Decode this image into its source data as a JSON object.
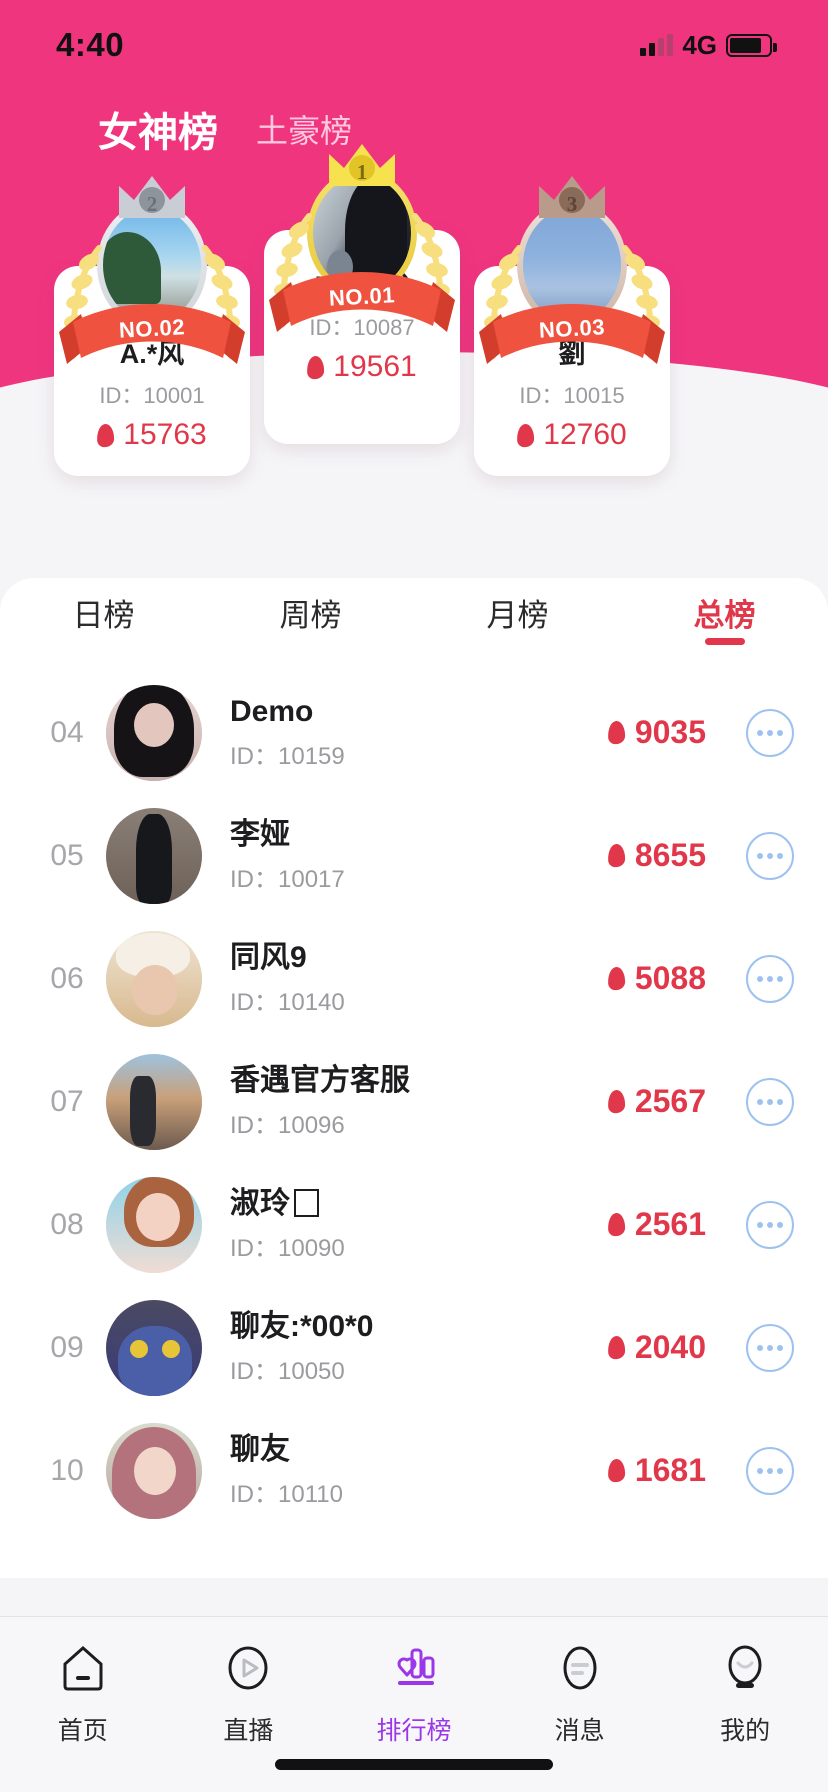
{
  "status_bar": {
    "time": "4:40",
    "network": "4G",
    "signal_icon": "signal-bars-icon",
    "battery_icon": "battery-icon"
  },
  "header": {
    "tabs": [
      {
        "label": "女神榜",
        "active": true
      },
      {
        "label": "土豪榜",
        "active": false
      }
    ]
  },
  "podium": [
    {
      "rank": 2,
      "rank_label": "NO.02",
      "crown_number": "2",
      "crown_tier": "silver",
      "name": "A.*风",
      "id_label": "ID：10001",
      "hot": "15763"
    },
    {
      "rank": 1,
      "rank_label": "NO.01",
      "crown_number": "1",
      "crown_tier": "gold",
      "name": "Flori我",
      "id_label": "ID：10087",
      "hot": "19561"
    },
    {
      "rank": 3,
      "rank_label": "NO.03",
      "crown_number": "3",
      "crown_tier": "bronze",
      "name": "劉",
      "id_label": "ID：10015",
      "hot": "12760"
    }
  ],
  "period_tabs": [
    {
      "label": "日榜",
      "active": false
    },
    {
      "label": "周榜",
      "active": false
    },
    {
      "label": "月榜",
      "active": false
    },
    {
      "label": "总榜",
      "active": true
    }
  ],
  "list": [
    {
      "rank": "04",
      "name": "Demo",
      "name_has_tofu": false,
      "id_label": "ID：10159",
      "hot": "9035"
    },
    {
      "rank": "05",
      "name": "李娅",
      "name_has_tofu": false,
      "id_label": "ID：10017",
      "hot": "8655"
    },
    {
      "rank": "06",
      "name": "同风9",
      "name_has_tofu": false,
      "id_label": "ID：10140",
      "hot": "5088"
    },
    {
      "rank": "07",
      "name": "香遇官方客服",
      "name_has_tofu": false,
      "id_label": "ID：10096",
      "hot": "2567"
    },
    {
      "rank": "08",
      "name": "淑玲",
      "name_has_tofu": true,
      "id_label": "ID：10090",
      "hot": "2561"
    },
    {
      "rank": "09",
      "name": "聊友:*00*0",
      "name_has_tofu": false,
      "id_label": "ID：10050",
      "hot": "2040"
    },
    {
      "rank": "10",
      "name": "聊友",
      "name_has_tofu": false,
      "id_label": "ID：10110",
      "hot": "1681"
    }
  ],
  "tabbar": [
    {
      "label": "首页",
      "icon": "home-icon",
      "active": false
    },
    {
      "label": "直播",
      "icon": "play-icon",
      "active": false
    },
    {
      "label": "排行榜",
      "icon": "ranking-icon",
      "active": true
    },
    {
      "label": "消息",
      "icon": "message-icon",
      "active": false
    },
    {
      "label": "我的",
      "icon": "profile-icon",
      "active": false
    }
  ],
  "colors": {
    "hero_pink": "#f0357f",
    "hot_red": "#e0384a",
    "accent_purple": "#9b37e8",
    "ribbon_red": "#ef5340",
    "gold": "#e8c83c"
  }
}
